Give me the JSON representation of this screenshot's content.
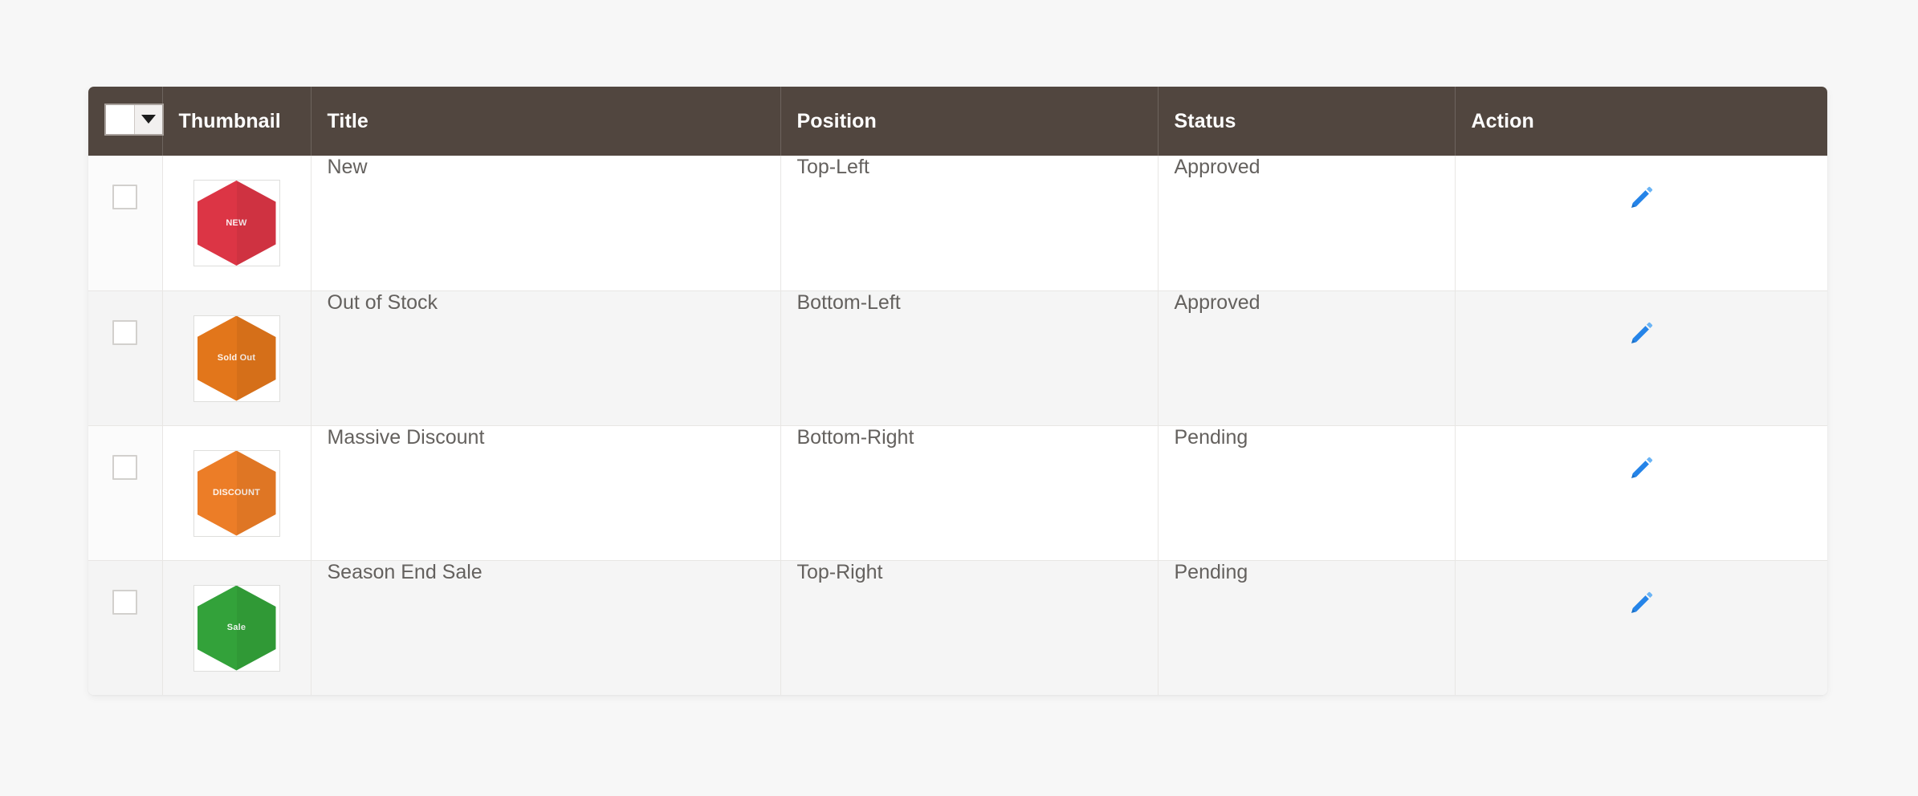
{
  "grid": {
    "columns": [
      {
        "key": "checkbox",
        "label": ""
      },
      {
        "key": "thumbnail",
        "label": "Thumbnail"
      },
      {
        "key": "title",
        "label": "Title"
      },
      {
        "key": "position",
        "label": "Position"
      },
      {
        "key": "status",
        "label": "Status"
      },
      {
        "key": "action",
        "label": "Action"
      }
    ],
    "header": {
      "massaction_icon": "checkbox-dropdown-icon",
      "thumbnail_label": "Thumbnail",
      "title_label": "Title",
      "position_label": "Position",
      "status_label": "Status",
      "action_label": "Action"
    },
    "rows": [
      {
        "checked": false,
        "thumbnail": {
          "icon": "hexagon-badge-icon",
          "label": "NEW",
          "color": "#dc3545",
          "shape": "hexagon"
        },
        "title": "New",
        "position": "Top-Left",
        "status": "Approved",
        "action": {
          "icon": "edit-pencil-icon",
          "color": "#2584e8"
        }
      },
      {
        "checked": false,
        "thumbnail": {
          "icon": "hexagon-badge-icon",
          "label": "Sold Out",
          "color": "#e2761b",
          "shape": "hexagon"
        },
        "title": "Out of Stock",
        "position": "Bottom-Left",
        "status": "Approved",
        "action": {
          "icon": "edit-pencil-icon",
          "color": "#2584e8"
        }
      },
      {
        "checked": false,
        "thumbnail": {
          "icon": "hexagon-badge-icon",
          "label": "DISCOUNT",
          "color": "#ec7d27",
          "shape": "hexagon"
        },
        "title": "Massive Discount",
        "position": "Bottom-Right",
        "status": "Pending",
        "action": {
          "icon": "edit-pencil-icon",
          "color": "#2584e8"
        }
      },
      {
        "checked": false,
        "thumbnail": {
          "icon": "hexagon-badge-icon",
          "label": "Sale",
          "color": "#33a23a",
          "shape": "hexagon"
        },
        "title": "Season End Sale",
        "position": "Top-Right",
        "status": "Pending",
        "action": {
          "icon": "edit-pencil-icon",
          "color": "#2584e8"
        }
      }
    ]
  },
  "theme": {
    "page_background": "#f7f7f7",
    "header_background": "#51463f",
    "header_text": "#ffffff",
    "body_text": "#64615e",
    "row_alt_background": "#f5f5f5",
    "grid_border": "#e8e6e4",
    "accent": "#2584e8"
  }
}
